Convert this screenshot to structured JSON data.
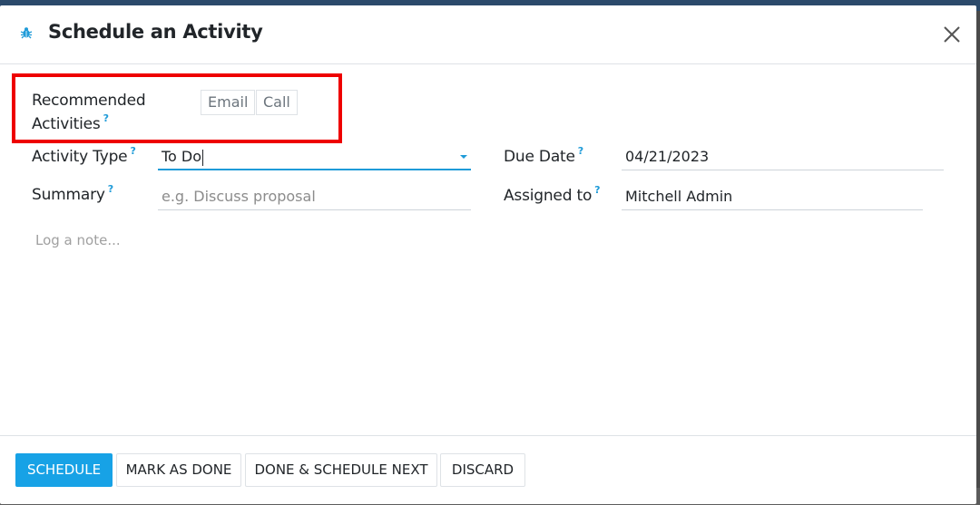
{
  "dialog": {
    "title": "Schedule an Activity"
  },
  "recommended": {
    "label_line1": "Recommended",
    "label_line2": "Activities",
    "help": "?",
    "items": [
      "Email",
      "Call"
    ]
  },
  "form": {
    "activity_type": {
      "label": "Activity Type",
      "help": "?",
      "value": "To Do"
    },
    "summary": {
      "label": "Summary",
      "help": "?",
      "placeholder": "e.g. Discuss proposal"
    },
    "due_date": {
      "label": "Due Date",
      "help": "?",
      "value": "04/21/2023"
    },
    "assigned_to": {
      "label": "Assigned to",
      "help": "?",
      "value": "Mitchell Admin"
    },
    "note": {
      "placeholder": "Log a note..."
    }
  },
  "footer": {
    "schedule": "Schedule",
    "mark_done": "Mark as Done",
    "done_next": "Done & Schedule Next",
    "discard": "Discard"
  },
  "colors": {
    "accent": "#17a2e6",
    "highlight": "#ee0000"
  },
  "icons": {
    "title_icon": "bug-icon",
    "close": "close-icon",
    "dropdown": "caret-down-icon"
  }
}
